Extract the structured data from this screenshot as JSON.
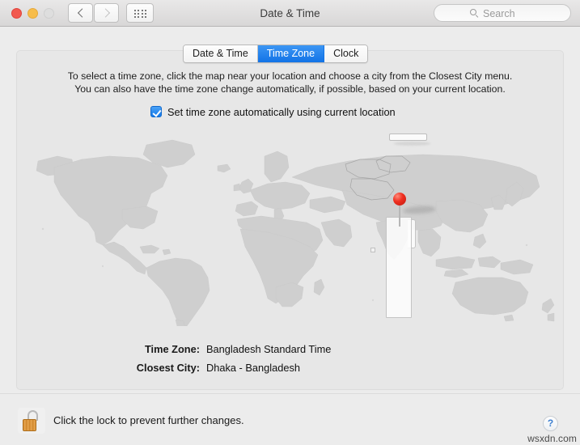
{
  "window": {
    "title": "Date & Time",
    "traffic_lights": {
      "close": "close-button",
      "minimize": "minimize-button",
      "zoom": "zoom-button-disabled"
    },
    "nav": {
      "back_label": "‹",
      "forward_label": "›"
    },
    "grid_label": "show-all-preferences"
  },
  "search": {
    "placeholder": "Search",
    "value": ""
  },
  "tabs": [
    {
      "label": "Date & Time",
      "selected": false
    },
    {
      "label": "Time Zone",
      "selected": true
    },
    {
      "label": "Clock",
      "selected": false
    }
  ],
  "main": {
    "description_line1": "To select a time zone, click the map near your location and choose a city from the Closest City menu.",
    "description_line2": "You can also have the time zone change automatically, if possible, based on your current location.",
    "auto_timezone": {
      "label": "Set time zone automatically using current location",
      "checked": true
    },
    "info": [
      {
        "label": "Time Zone:",
        "value": "Bangladesh Standard Time"
      },
      {
        "label": "Closest City:",
        "value": "Dhaka - Bangladesh"
      }
    ]
  },
  "footer": {
    "lock_text": "Click the lock to prevent further changes.",
    "lock_state": "unlocked",
    "help_label": "?"
  },
  "watermark": "wsxdn.com",
  "colors": {
    "accent_blue": "#1278e8",
    "pin_red": "#ef2f20",
    "lock_gold": "#d98f33",
    "map_land": "#cfcfcf",
    "map_sea": "#e7e7e7",
    "panel_bg": "#e7e7e7"
  }
}
